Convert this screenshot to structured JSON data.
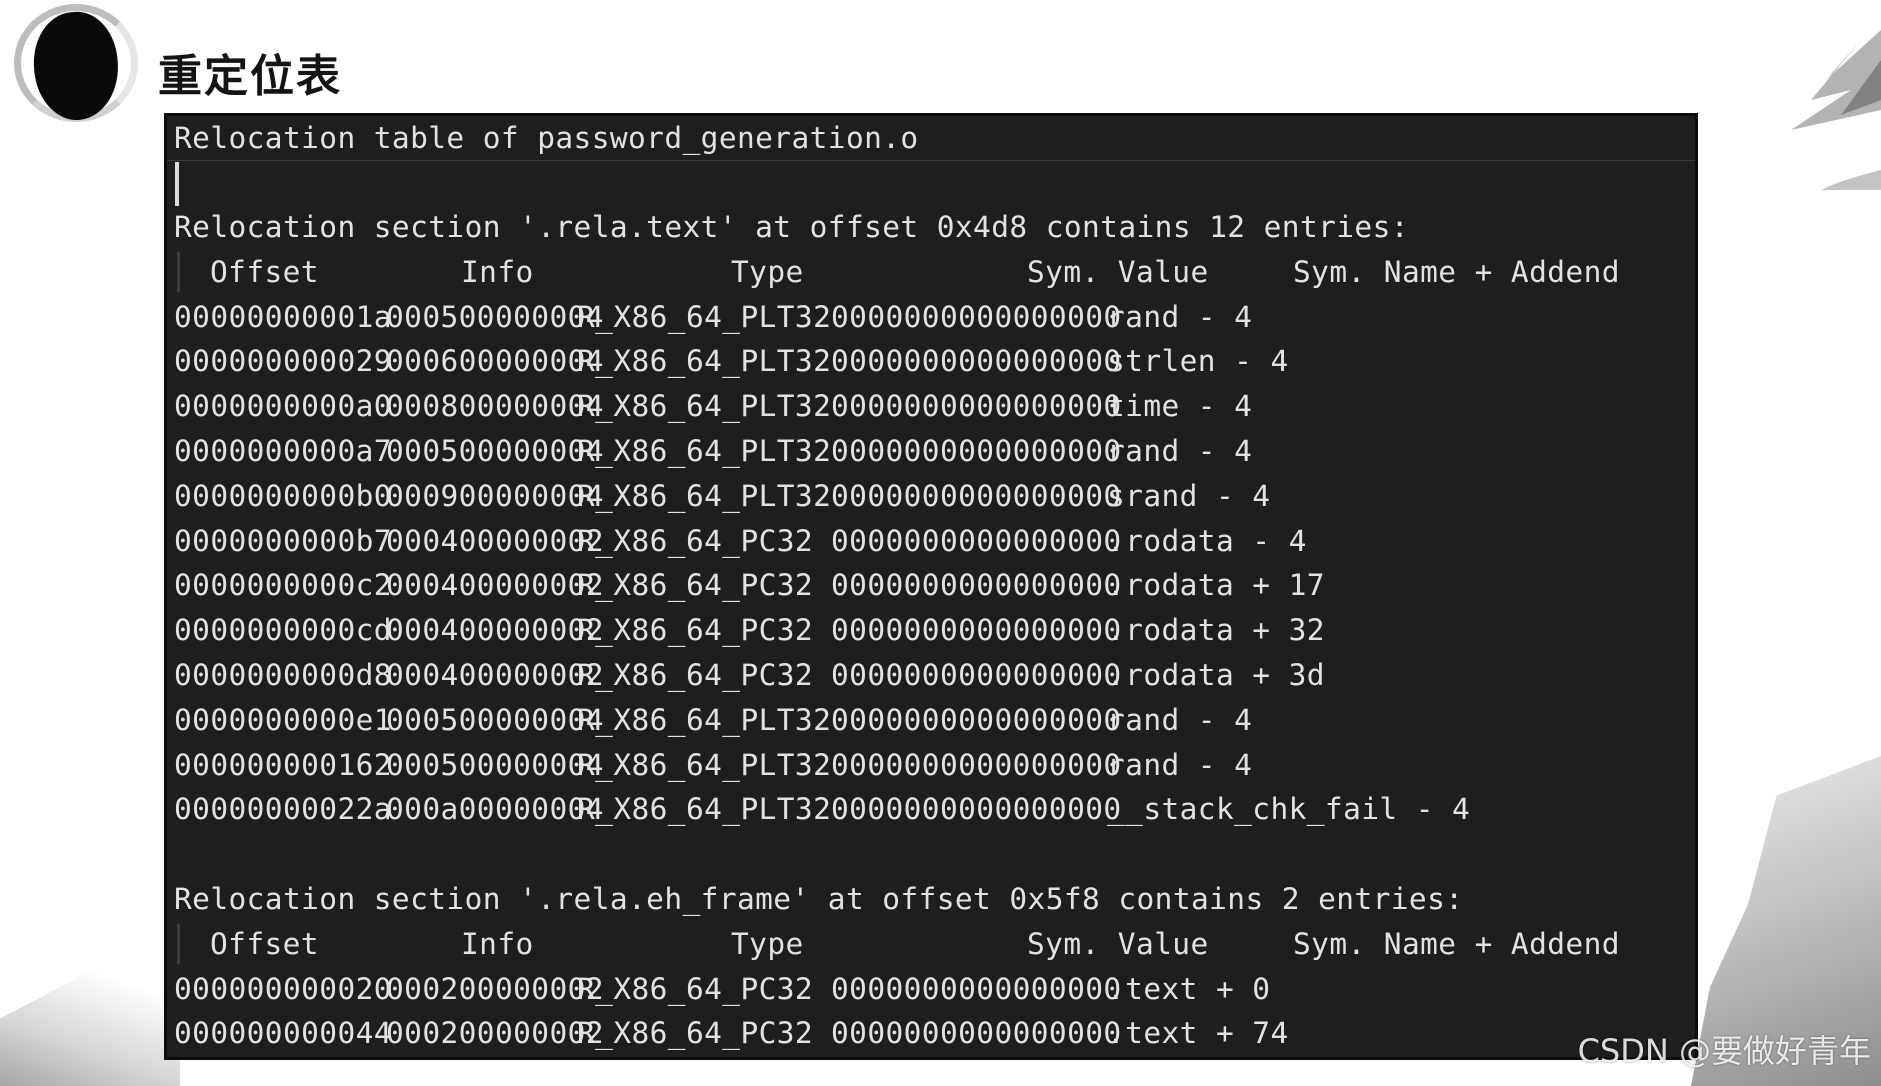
{
  "slide": {
    "title": "重定位表",
    "watermark": "CSDN @要做好青年"
  },
  "terminal": {
    "heading": "Relocation table of password_generation.o",
    "sections": [
      {
        "header": "Relocation section '.rela.text' at offset 0x4d8 contains 12 entries:",
        "columns": [
          "Offset",
          "Info",
          "Type",
          "Sym. Value",
          "Sym. Name + Addend"
        ],
        "rows": [
          [
            "00000000001a",
            "000500000004",
            "R_X86_64_PLT32",
            "0000000000000000",
            "rand - 4"
          ],
          [
            "000000000029",
            "000600000004",
            "R_X86_64_PLT32",
            "0000000000000000",
            "strlen - 4"
          ],
          [
            "0000000000a0",
            "000800000004",
            "R_X86_64_PLT32",
            "0000000000000000",
            "time - 4"
          ],
          [
            "0000000000a7",
            "000500000004",
            "R_X86_64_PLT32",
            "0000000000000000",
            "rand - 4"
          ],
          [
            "0000000000b0",
            "000900000004",
            "R_X86_64_PLT32",
            "0000000000000000",
            "srand - 4"
          ],
          [
            "0000000000b7",
            "000400000002",
            "R_X86_64_PC32",
            "0000000000000000",
            ".rodata - 4"
          ],
          [
            "0000000000c2",
            "000400000002",
            "R_X86_64_PC32",
            "0000000000000000",
            ".rodata + 17"
          ],
          [
            "0000000000cd",
            "000400000002",
            "R_X86_64_PC32",
            "0000000000000000",
            ".rodata + 32"
          ],
          [
            "0000000000d8",
            "000400000002",
            "R_X86_64_PC32",
            "0000000000000000",
            ".rodata + 3d"
          ],
          [
            "0000000000e1",
            "000500000004",
            "R_X86_64_PLT32",
            "0000000000000000",
            "rand - 4"
          ],
          [
            "000000000162",
            "000500000004",
            "R_X86_64_PLT32",
            "0000000000000000",
            "rand - 4"
          ],
          [
            "00000000022a",
            "000a00000004",
            "R_X86_64_PLT32",
            "0000000000000000",
            "__stack_chk_fail - 4"
          ]
        ]
      },
      {
        "header": "Relocation section '.rela.eh_frame' at offset 0x5f8 contains 2 entries:",
        "columns": [
          "Offset",
          "Info",
          "Type",
          "Sym. Value",
          "Sym. Name + Addend"
        ],
        "rows": [
          [
            "000000000020",
            "000200000002",
            "R_X86_64_PC32",
            "0000000000000000",
            ".text + 0"
          ],
          [
            "000000000044",
            "000200000002",
            "R_X86_64_PC32",
            "0000000000000000",
            ".text + 74"
          ]
        ]
      }
    ]
  },
  "colors": {
    "terminal_bg": "#1e1e1e",
    "terminal_fg": "#e2e2e2",
    "slide_bg": "#ffffff"
  },
  "icons": [
    "ink-circle-icon",
    "ink-brush-decoration"
  ]
}
